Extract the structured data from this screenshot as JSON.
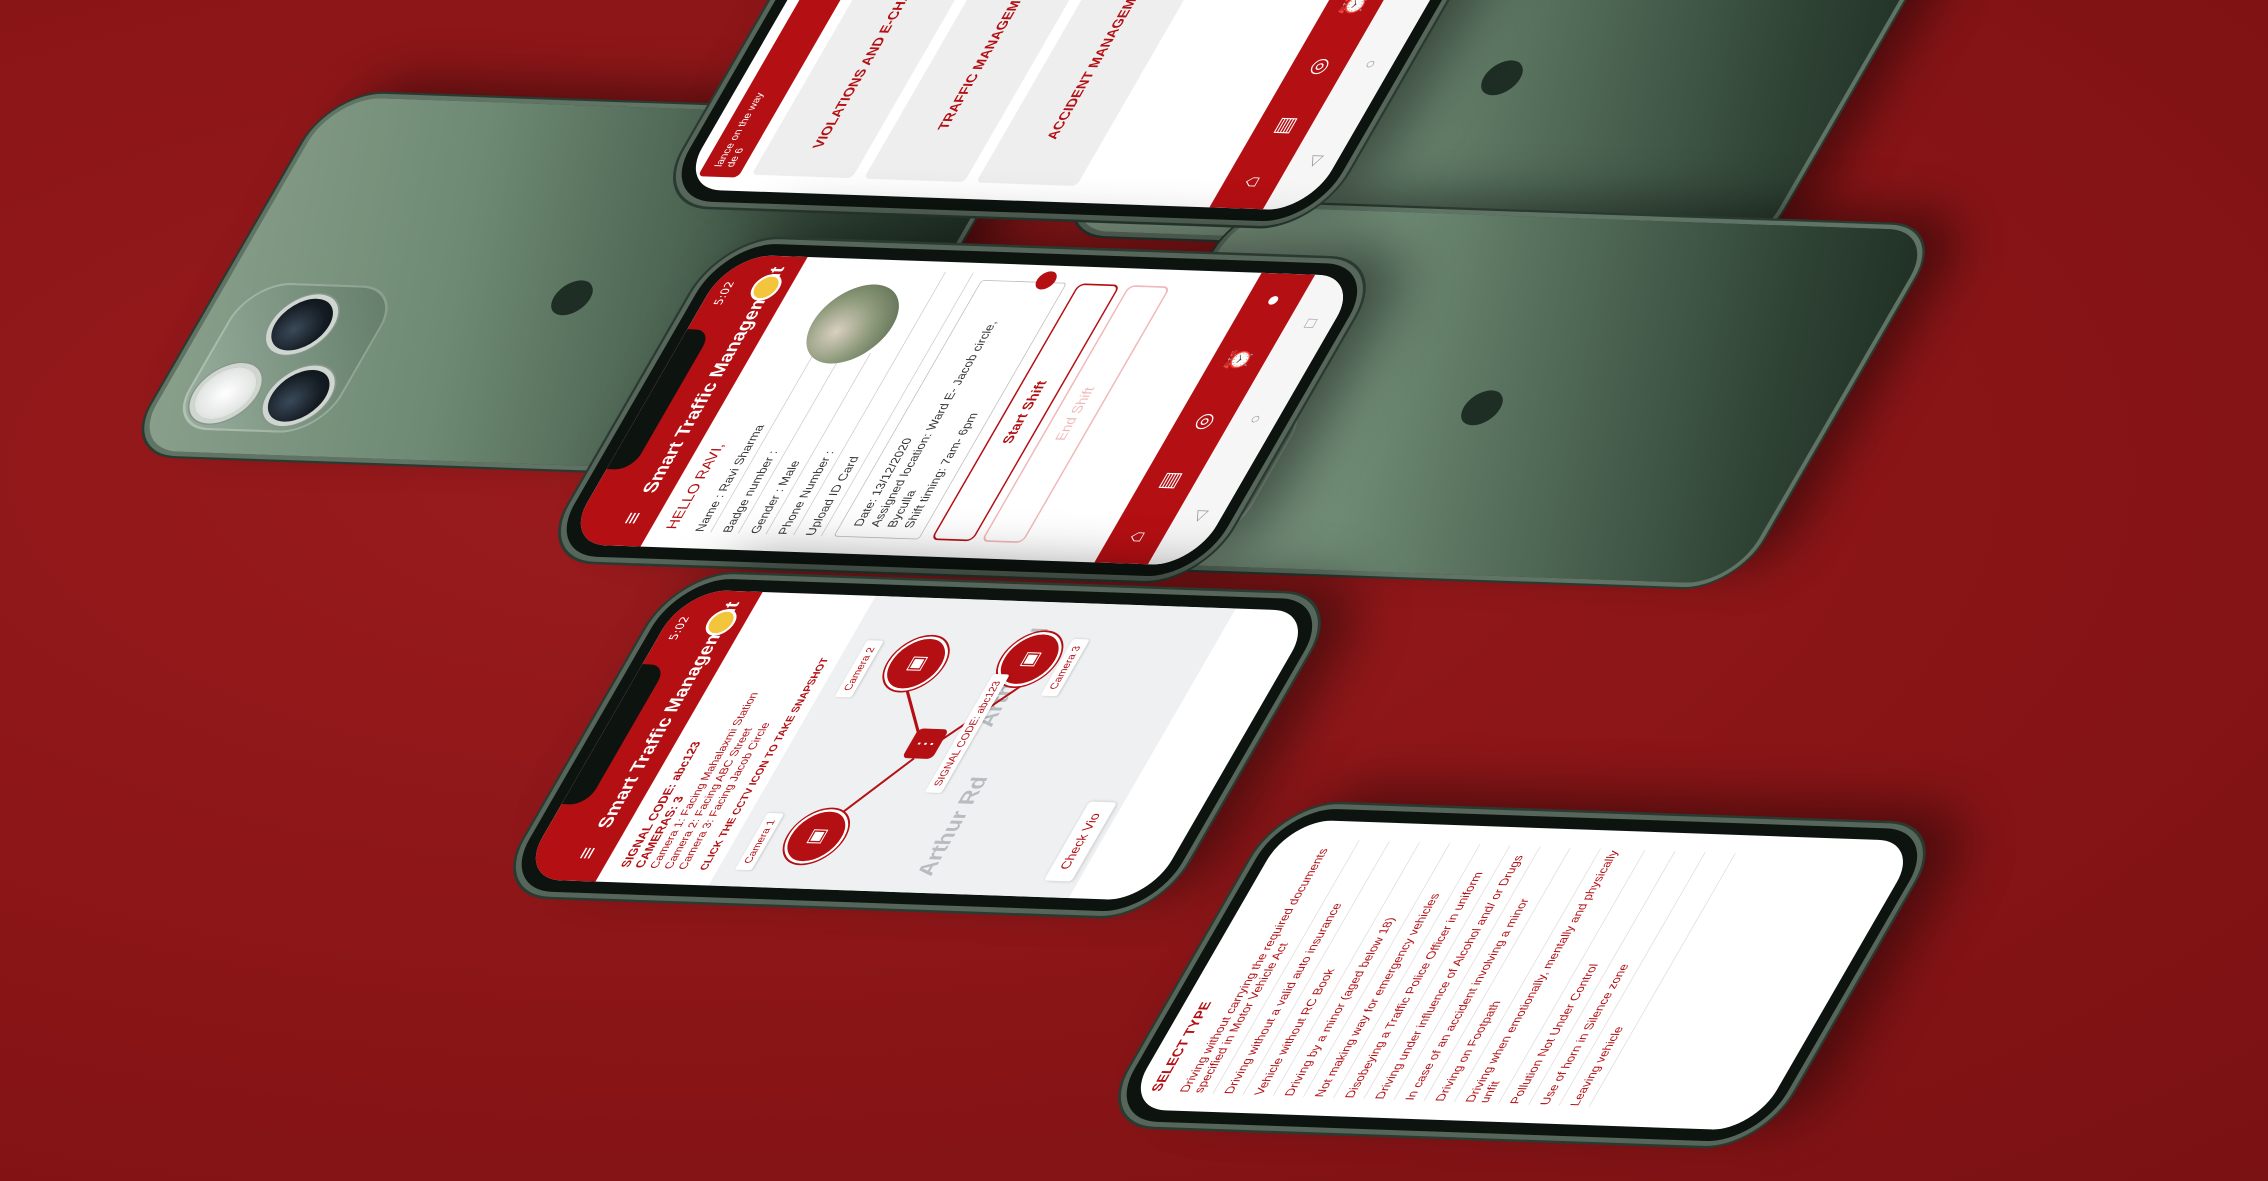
{
  "app": {
    "title": "Smart Traffic Management",
    "status_time": "5:02",
    "menu_glyph": "≡"
  },
  "colors": {
    "background": "#8e1719",
    "brand_red": "#b40f13",
    "phone_green": "#5f7a66"
  },
  "icons": {
    "home": "home-icon",
    "chat": "chat-icon",
    "signal": "signal-icon",
    "alarm": "alarm-icon",
    "profile": "profile-icon",
    "menu": "hamburger-menu-icon",
    "camera": "cctv-camera-icon",
    "traffic_light": "traffic-light-icon"
  },
  "nav_glyphs": {
    "home": "⌂",
    "chat": "▤",
    "signal": "◎",
    "alarm": "⏰",
    "profile": "●",
    "back": "◁",
    "circle": "○",
    "square": "□"
  },
  "menu_screen": {
    "banner": "lance on the way",
    "banner_sub": "de 6",
    "cards": [
      "VIOLATIONS AND E-CHALLANS",
      "TRAFFIC MANAGEMENT",
      "ACCIDENT MANAGEMENT"
    ]
  },
  "profile_screen": {
    "greeting": "HELLO RAVI,",
    "name": "Name : Ravi Sharma",
    "badge": "Badge number :",
    "gender": "Gender : Male",
    "phone": "Phone Number :",
    "upload": "Upload ID Card",
    "date": "Date: 13/12/2020",
    "location": "Assigned location: Ward E- Jacob circle, Byculla",
    "shift": "Shift timing: 7am- 6pm",
    "start_button": "Start Shift",
    "end_button": "End Shift"
  },
  "signal_screen": {
    "signal_code": "SIGNAL CODE: abc123",
    "cameras": "CAMERAS: 3",
    "camera1": "Camera 1: Facing Mahalaxmi Station",
    "camera2": "Camera 2: Facing ABC Street",
    "camera3": "Camera 3: Facing Jacob Circle",
    "instruction": "CLICK THE CCTV ICON TO TAKE SNAPSHOT",
    "cam_label_1": "Camera 1",
    "cam_label_2": "Camera 2",
    "cam_label_3": "Camera 3",
    "center_label": "SIGNAL CODE: abc123",
    "road_1": "Arthur Rd",
    "road_2": "Arthur Rd",
    "check_button": "Check Vio"
  },
  "violations_screen": {
    "heading": "SELECT TYPE",
    "items": [
      "Driving without carrying the required documents specified in Motor Vehicle Act",
      "Driving without a valid auto insurance",
      "Vehicle without RC Book",
      "Driving by a minor (aged below 18)",
      "Not making way for emergency vehicles",
      "Disobeying a Traffic Police Officer in uniform",
      "Driving under influence of Alcohol and/ or Drugs",
      "In case of an accident involving a minor",
      "Driving on Footpath",
      "Driving when emotionally, mentally and physically unfit",
      "Pollution Not Under Control",
      "Use of horn in Silence zone",
      "Leaving vehicle"
    ]
  }
}
